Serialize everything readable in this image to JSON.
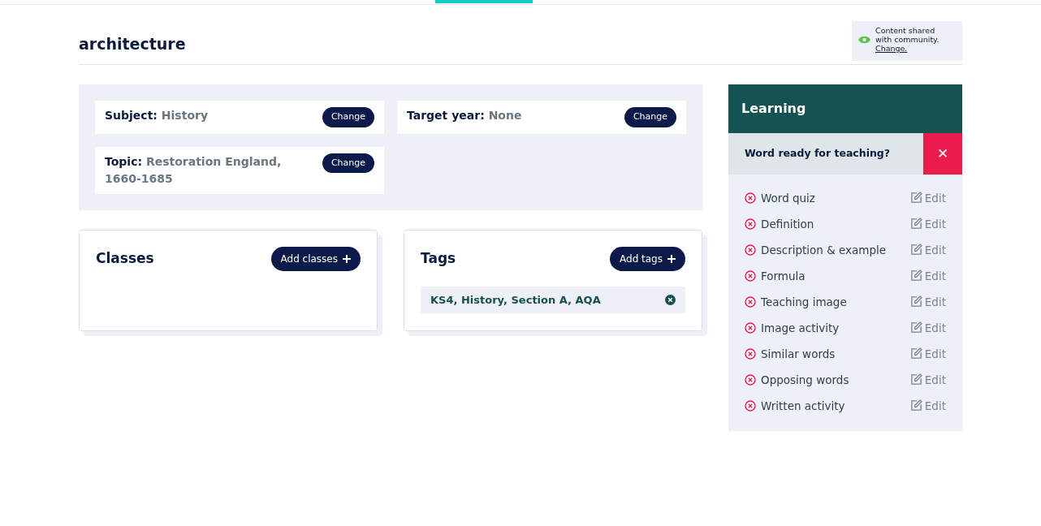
{
  "title": "architecture",
  "sharing": {
    "shared": true,
    "text": "Content shared with community.",
    "link": "Change."
  },
  "properties": [
    {
      "label": "Subject:",
      "value": "History",
      "button": "Change"
    },
    {
      "label": "Target year:",
      "value": "None",
      "button": "Change"
    },
    {
      "label": "Topic:",
      "value": "Restoration England, 1660-1685",
      "button": "Change"
    }
  ],
  "classes": {
    "title": "Classes",
    "button": "Add classes"
  },
  "tags": {
    "title": "Tags",
    "button": "Add tags",
    "items": [
      "KS4, History, Section A, AQA"
    ]
  },
  "learning": {
    "title": "Learning",
    "question": "Word ready for teaching?",
    "ready": false,
    "ready_icon": "✕",
    "items": [
      {
        "label": "Word quiz",
        "done": false,
        "action": "Edit"
      },
      {
        "label": "Definition",
        "done": false,
        "action": "Edit"
      },
      {
        "label": "Description & example",
        "done": false,
        "action": "Edit"
      },
      {
        "label": "Formula",
        "done": false,
        "action": "Edit"
      },
      {
        "label": "Teaching image",
        "done": false,
        "action": "Edit"
      },
      {
        "label": "Image activity",
        "done": false,
        "action": "Edit"
      },
      {
        "label": "Similar words",
        "done": false,
        "action": "Edit"
      },
      {
        "label": "Opposing words",
        "done": false,
        "action": "Edit"
      },
      {
        "label": "Written activity",
        "done": false,
        "action": "Edit"
      }
    ]
  }
}
